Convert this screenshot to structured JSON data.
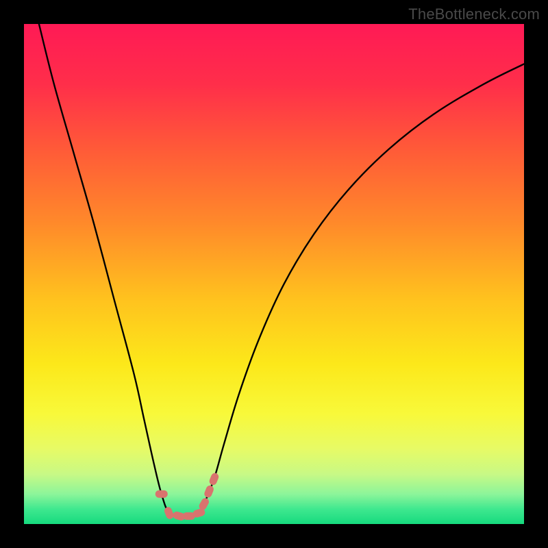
{
  "watermark": "TheBottleneck.com",
  "chart_data": {
    "type": "line",
    "title": "",
    "xlabel": "",
    "ylabel": "",
    "xlim": [
      0,
      100
    ],
    "ylim": [
      0,
      100
    ],
    "curve": {
      "x": [
        3,
        6,
        10,
        14,
        18,
        22,
        24,
        26,
        27.5,
        29,
        31,
        33,
        35,
        36,
        38,
        40,
        43,
        47,
        52,
        58,
        65,
        73,
        82,
        92,
        100
      ],
      "y": [
        100,
        88,
        74,
        60,
        45,
        30,
        21,
        12,
        6,
        2.2,
        1.6,
        1.6,
        2.2,
        4,
        9,
        16,
        26,
        37,
        48,
        58,
        67,
        75,
        82,
        88,
        92
      ]
    },
    "markers": {
      "x": [
        27.5,
        29,
        31,
        33,
        35,
        36,
        37,
        38
      ],
      "y": [
        6,
        2.2,
        1.6,
        1.6,
        2.2,
        4,
        6.5,
        9
      ]
    },
    "gradient_stops": [
      {
        "offset": 0.0,
        "color": "#ff1a55"
      },
      {
        "offset": 0.12,
        "color": "#ff2e4a"
      },
      {
        "offset": 0.25,
        "color": "#ff5a38"
      },
      {
        "offset": 0.4,
        "color": "#ff8a2a"
      },
      {
        "offset": 0.55,
        "color": "#ffc21e"
      },
      {
        "offset": 0.68,
        "color": "#fce81a"
      },
      {
        "offset": 0.78,
        "color": "#f8f93a"
      },
      {
        "offset": 0.85,
        "color": "#e7fa66"
      },
      {
        "offset": 0.9,
        "color": "#c8f985"
      },
      {
        "offset": 0.94,
        "color": "#8df59a"
      },
      {
        "offset": 0.97,
        "color": "#3fe88f"
      },
      {
        "offset": 1.0,
        "color": "#16da7e"
      }
    ],
    "marker_color": "#d9736e",
    "curve_color": "#000000"
  }
}
